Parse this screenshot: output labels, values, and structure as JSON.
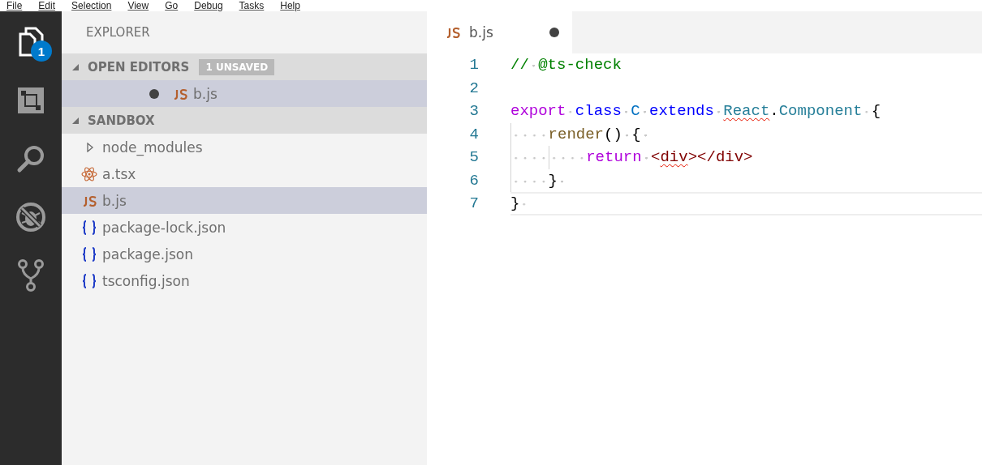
{
  "menu_bar": [
    {
      "label": "File"
    },
    {
      "label": "Edit"
    },
    {
      "label": "Selection"
    },
    {
      "label": "View"
    },
    {
      "label": "Go"
    },
    {
      "label": "Debug"
    },
    {
      "label": "Tasks"
    },
    {
      "label": "Help"
    }
  ],
  "activity_bar": [
    {
      "kind": "files",
      "selected": true,
      "badge": "1"
    },
    {
      "kind": "extensions",
      "selected": false
    },
    {
      "kind": "search",
      "selected": false
    },
    {
      "kind": "debug",
      "selected": false
    },
    {
      "kind": "git",
      "selected": false
    }
  ],
  "sidebar": {
    "title": "EXPLORER",
    "open_editors": {
      "title": "OPEN EDITORS",
      "expanded": true,
      "badge": "1 UNSAVED",
      "items": [
        {
          "name": "b.js",
          "kind": "js",
          "dirty": true,
          "selected": true
        }
      ]
    },
    "folder": {
      "title": "SANDBOX",
      "expanded": true,
      "items": [
        {
          "name": "node_modules",
          "kind": "folder",
          "expanded": false,
          "selected": false
        },
        {
          "name": "a.tsx",
          "kind": "react",
          "selected": false
        },
        {
          "name": "b.js",
          "kind": "js",
          "selected": true
        },
        {
          "name": "package-lock.json",
          "kind": "json",
          "selected": false
        },
        {
          "name": "package.json",
          "kind": "json",
          "selected": false
        },
        {
          "name": "tsconfig.json",
          "kind": "json",
          "selected": false
        }
      ]
    }
  },
  "editor": {
    "tabs": [
      {
        "name": "b.js",
        "kind": "js",
        "dirty": true,
        "selected": true
      }
    ],
    "lines": [
      {
        "number": "1",
        "current": false,
        "tokens": [
          {
            "kind": "comment",
            "text": "// @ts-check",
            "error": false
          }
        ]
      },
      {
        "number": "2",
        "current": false
      },
      {
        "number": "3",
        "current": false,
        "tokens": [
          {
            "kind": "keyword",
            "text": "export ",
            "error": false
          },
          {
            "kind": "storage",
            "text": "class ",
            "error": false
          },
          {
            "kind": "entity",
            "text": "C ",
            "error": false
          },
          {
            "kind": "storage",
            "text": "extends ",
            "error": false
          },
          {
            "kind": "type",
            "text": "React",
            "error": true
          },
          {
            "kind": "plain",
            "text": ".",
            "error": false
          },
          {
            "kind": "type",
            "text": "Component ",
            "error": false
          },
          {
            "kind": "plain",
            "text": "{",
            "error": false
          }
        ]
      },
      {
        "number": "4",
        "current": false,
        "tokens": [
          {
            "kind": "function",
            "text": "    render",
            "error": false
          },
          {
            "kind": "plain",
            "text": "() { ",
            "error": false
          }
        ]
      },
      {
        "number": "5",
        "current": false,
        "tokens": [
          {
            "kind": "keyword",
            "text": "        return ",
            "error": false
          },
          {
            "kind": "tag",
            "text": "<",
            "error": false
          },
          {
            "kind": "tag",
            "text": "div",
            "error": true
          },
          {
            "kind": "tag",
            "text": "></div>",
            "error": false
          }
        ]
      },
      {
        "number": "6",
        "current": false,
        "tokens": [
          {
            "kind": "plain",
            "text": "    } ",
            "error": false
          }
        ]
      },
      {
        "number": "7",
        "current": true,
        "tokens": [
          {
            "kind": "plain",
            "text": "} ",
            "error": false
          }
        ]
      }
    ]
  }
}
